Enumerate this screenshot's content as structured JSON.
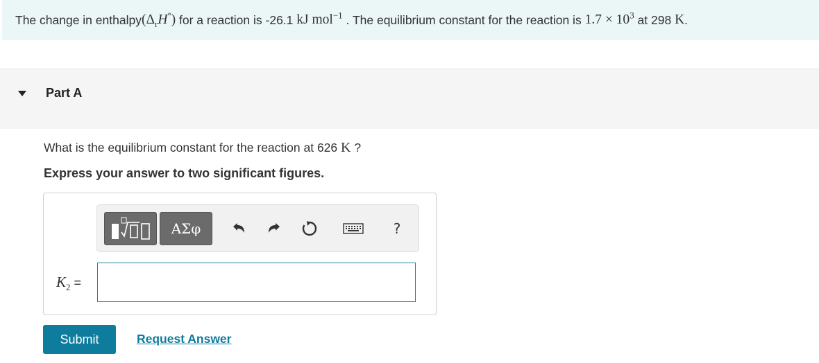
{
  "intro": {
    "t1": "The change in enthalpy ",
    "lparen": "(",
    "delta": "Δ",
    "r_sub": "r",
    "H": "H",
    "degree": "°",
    "rparen": ")",
    "t2": " for a reaction is -26.1 ",
    "unit_kj": "kJ mol",
    "unit_exp": "−1",
    "t3": " . The equilibrium constant for the reaction is ",
    "k_mantissa": "1.7 × 10",
    "k_exp": "3",
    "t4": " at 298 ",
    "kelvin": "K",
    "t5": "."
  },
  "part": {
    "title": "Part A"
  },
  "question": {
    "t1": "What is the equilibrium constant for the reaction at 626 ",
    "kelvin": "K",
    "t2": " ?",
    "instruction": "Express your answer to two significant figures."
  },
  "toolbar": {
    "greek_label": "ΑΣφ",
    "help_label": "?",
    "icons": [
      "templates-icon",
      "greek-letters-icon",
      "undo-icon",
      "redo-icon",
      "reset-icon",
      "keyboard-icon",
      "help-icon"
    ]
  },
  "answer": {
    "k_symbol": "K",
    "k_sub": "2",
    "equals": " =",
    "value": ""
  },
  "actions": {
    "submit_label": "Submit",
    "request_label": "Request Answer"
  },
  "colors": {
    "intro_bg": "#ebf6f7",
    "accent": "#0e7c9d",
    "part_bg": "#f5f5f5"
  }
}
